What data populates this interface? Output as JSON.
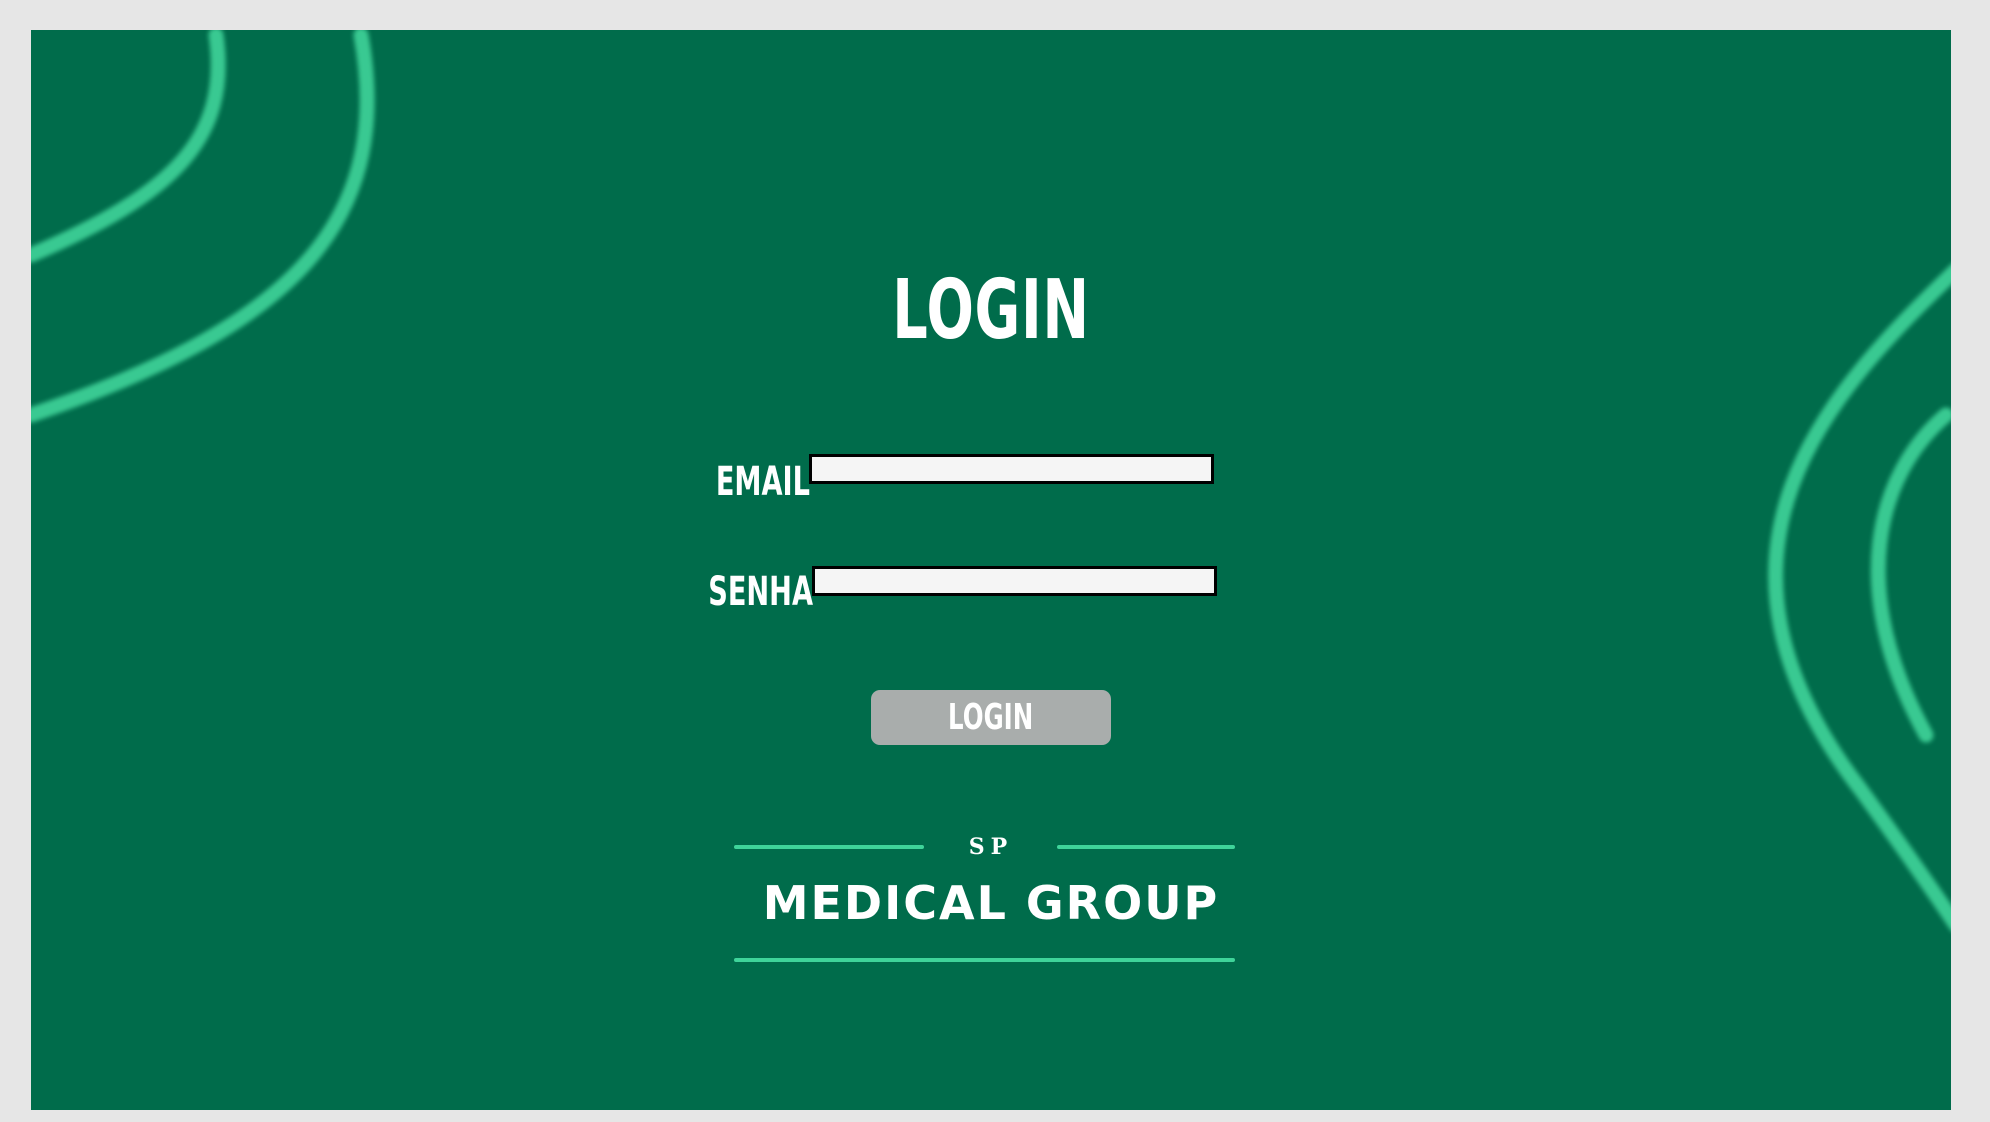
{
  "login": {
    "title": "LOGIN",
    "email_label": "EMAIL",
    "email_value": "",
    "password_label": "SENHA",
    "password_value": "",
    "submit_label": "LOGIN"
  },
  "logo": {
    "top_text": "SP",
    "name": "MEDICAL GROUP"
  },
  "colors": {
    "background": "#006c4b",
    "accent": "#3fd49a",
    "button": "#a9adac",
    "outer": "#e6e6e6"
  }
}
